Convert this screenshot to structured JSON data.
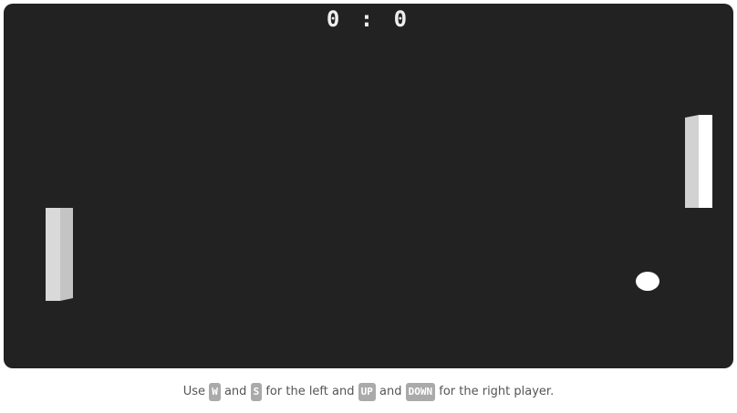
{
  "score": {
    "left": "0",
    "separator": ":",
    "right": "0"
  },
  "instructions": {
    "prefix": "Use",
    "key_left_up": "W",
    "and_1": "and",
    "key_left_down": "S",
    "middle": "for the left and",
    "key_right_up": "UP",
    "and_2": "and",
    "key_right_down": "DOWN",
    "suffix": "for the right player."
  },
  "colors": {
    "field": "#222222",
    "paddle": "#ffffff",
    "ball": "#ffffff",
    "key_bg": "#aaaaaa"
  }
}
